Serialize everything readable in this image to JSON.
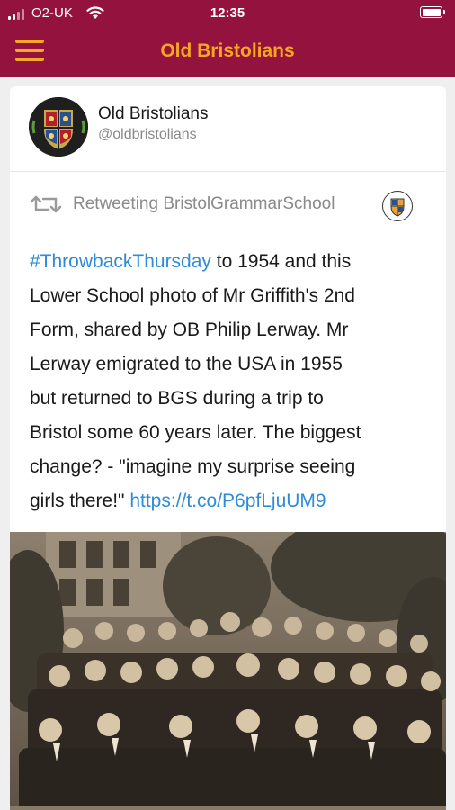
{
  "status_bar": {
    "carrier": "O2-UK",
    "time": "12:35"
  },
  "nav": {
    "title": "Old Bristolians",
    "menu_icon": "hamburger-menu-icon"
  },
  "colors": {
    "nav_background": "#93123e",
    "accent": "#f5a623",
    "link": "#2e8bd8"
  },
  "post": {
    "author_name": "Old Bristolians",
    "author_handle": "@oldbristolians",
    "retweet_label": "Retweeting BristolGrammarSchool",
    "retweet_icon": "retweet-icon",
    "lines": [
      {
        "link": "#ThrowbackThursday",
        "text": " to 1954 and this"
      },
      {
        "text": "Lower School photo of Mr Griffith's 2nd"
      },
      {
        "text": "Form, shared by OB Philip Lerway. Mr"
      },
      {
        "text": "Lerway emigrated to the USA in 1955"
      },
      {
        "text": "but returned to BGS during a trip to"
      },
      {
        "text": "Bristol some 60 years later. The biggest"
      },
      {
        "text": "change? - \"imagine my surprise seeing"
      },
      {
        "text": "girls there!\" ",
        "link": "https://t.co/P6pfLjuUM9"
      }
    ]
  }
}
